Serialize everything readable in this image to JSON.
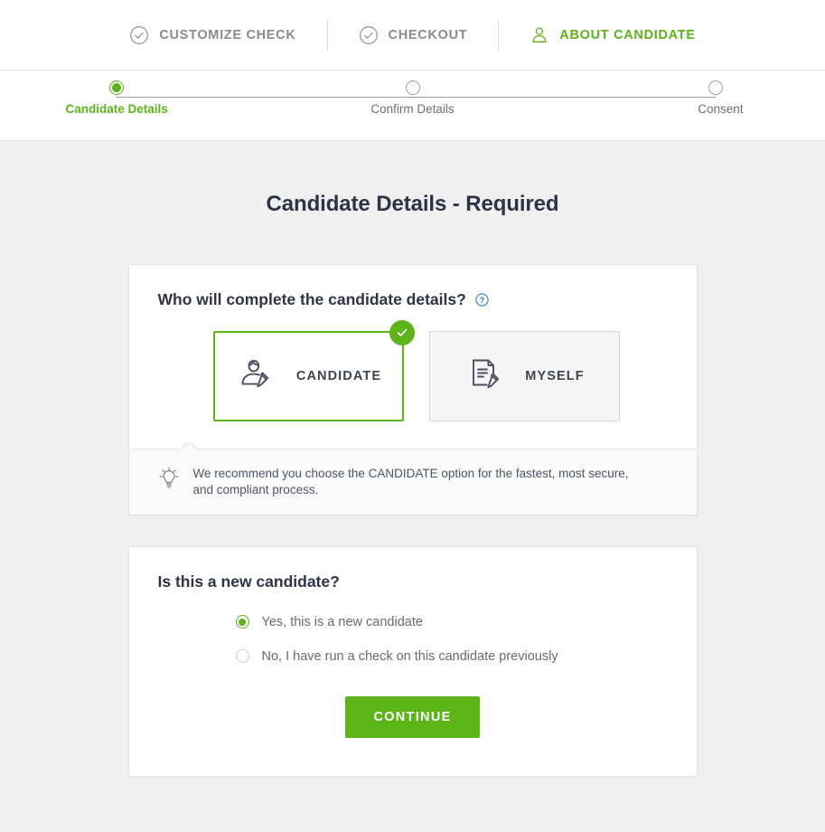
{
  "topnav": {
    "items": [
      {
        "label": "CUSTOMIZE CHECK",
        "icon": "check-circle-icon",
        "active": false
      },
      {
        "label": "CHECKOUT",
        "icon": "check-circle-icon",
        "active": false
      },
      {
        "label": "ABOUT CANDIDATE",
        "icon": "person-icon",
        "active": true
      }
    ]
  },
  "stepper": {
    "steps": [
      {
        "label": "Candidate Details",
        "state": "active"
      },
      {
        "label": "Confirm Details",
        "state": "pending"
      },
      {
        "label": "Consent",
        "state": "pending"
      }
    ]
  },
  "main": {
    "page_title": "Candidate Details - Required",
    "who_card": {
      "question": "Who will complete the candidate details?",
      "help_icon": "question-circle-icon",
      "choices": [
        {
          "label": "CANDIDATE",
          "icon": "person-edit-icon",
          "selected": true
        },
        {
          "label": "MYSELF",
          "icon": "document-edit-icon",
          "selected": false
        }
      ],
      "tip": {
        "icon": "lightbulb-icon",
        "text": "We recommend you choose the CANDIDATE option for the fastest, most secure, and compliant process."
      }
    },
    "new_candidate_card": {
      "question": "Is this a new candidate?",
      "options": [
        {
          "label": "Yes, this is a new candidate",
          "checked": true
        },
        {
          "label": "No, I have run a check on this candidate previously",
          "checked": false
        }
      ],
      "continue_label": "CONTINUE"
    }
  },
  "colors": {
    "brand_green": "#5cb418",
    "title_navy": "#2d3447",
    "page_bg": "#f0f0f0",
    "help_blue": "#2f7dc4",
    "muted_gray": "#8a8a8a"
  }
}
